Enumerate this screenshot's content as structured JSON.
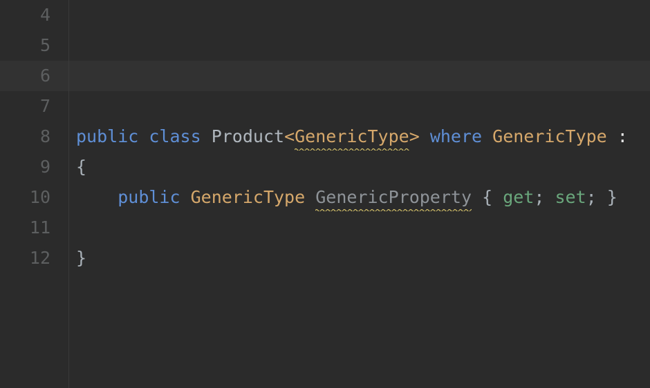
{
  "editor": {
    "first_line": 4,
    "current_line": 6,
    "lines": {
      "4": {
        "tokens": []
      },
      "5": {
        "tokens": []
      },
      "6": {
        "tokens": []
      },
      "7": {
        "tokens": []
      },
      "8": {
        "tokens": [
          {
            "t": "public",
            "c": "keyword"
          },
          {
            "t": " ",
            "c": "sp"
          },
          {
            "t": "class",
            "c": "class"
          },
          {
            "t": " ",
            "c": "sp"
          },
          {
            "t": "Product",
            "c": "type"
          },
          {
            "t": "<",
            "c": "generic"
          },
          {
            "t": "GenericType",
            "c": "generic",
            "squiggle": true
          },
          {
            "t": ">",
            "c": "generic"
          },
          {
            "t": " ",
            "c": "sp"
          },
          {
            "t": "where",
            "c": "keyword"
          },
          {
            "t": " ",
            "c": "sp"
          },
          {
            "t": "GenericType",
            "c": "generic2"
          },
          {
            "t": " ",
            "c": "sp"
          },
          {
            "t": ":",
            "c": "white"
          }
        ]
      },
      "9": {
        "tokens": [
          {
            "t": "{",
            "c": "punc"
          }
        ]
      },
      "10": {
        "indent": 1,
        "tokens": [
          {
            "t": "public",
            "c": "keyword"
          },
          {
            "t": " ",
            "c": "sp"
          },
          {
            "t": "GenericType",
            "c": "generic2"
          },
          {
            "t": " ",
            "c": "sp"
          },
          {
            "t": "GenericProperty",
            "c": "ident",
            "squiggle": true
          },
          {
            "t": " ",
            "c": "sp"
          },
          {
            "t": "{",
            "c": "punc"
          },
          {
            "t": " ",
            "c": "sp"
          },
          {
            "t": "get",
            "c": "accessor"
          },
          {
            "t": ";",
            "c": "punc"
          },
          {
            "t": " ",
            "c": "sp"
          },
          {
            "t": "set",
            "c": "accessor"
          },
          {
            "t": ";",
            "c": "punc"
          },
          {
            "t": " ",
            "c": "sp"
          },
          {
            "t": "}",
            "c": "punc"
          }
        ]
      },
      "11": {
        "tokens": []
      },
      "12": {
        "tokens": [
          {
            "t": "}",
            "c": "punc"
          }
        ]
      }
    }
  }
}
